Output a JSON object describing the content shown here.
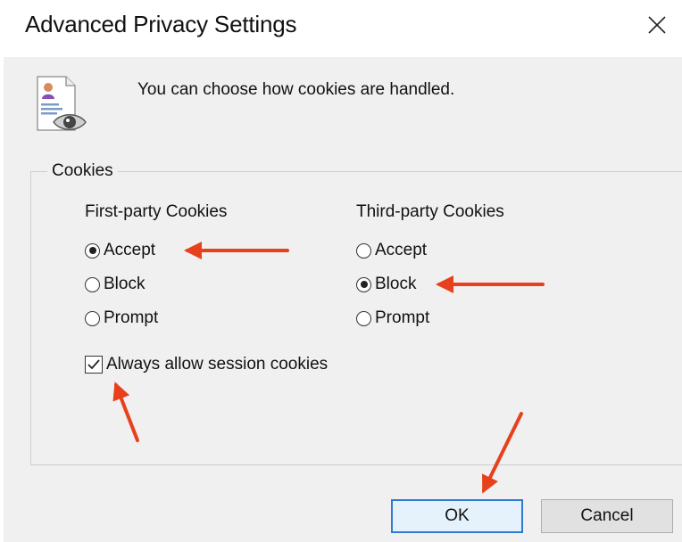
{
  "window": {
    "title": "Advanced Privacy Settings"
  },
  "intro": {
    "text": "You can choose how cookies are handled."
  },
  "cookies_group": {
    "legend": "Cookies",
    "first_party": {
      "heading": "First-party Cookies",
      "options": [
        {
          "label": "Accept",
          "selected": true
        },
        {
          "label": "Block",
          "selected": false
        },
        {
          "label": "Prompt",
          "selected": false
        }
      ]
    },
    "third_party": {
      "heading": "Third-party Cookies",
      "options": [
        {
          "label": "Accept",
          "selected": false
        },
        {
          "label": "Block",
          "selected": true
        },
        {
          "label": "Prompt",
          "selected": false
        }
      ]
    },
    "session_cookies": {
      "label": "Always allow session cookies",
      "checked": true
    }
  },
  "buttons": {
    "ok": "OK",
    "cancel": "Cancel"
  },
  "annotations": {
    "arrow_color": "#e8401c"
  },
  "icons": {
    "close": "close-icon",
    "privacy": "privacy-document-eye-icon"
  }
}
